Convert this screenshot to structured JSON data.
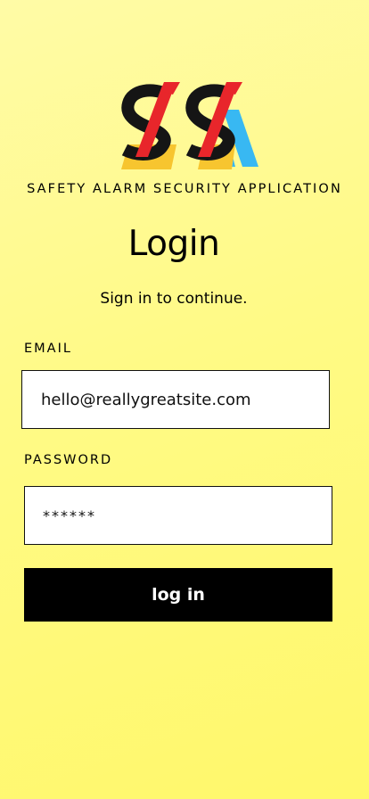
{
  "app": {
    "name": "SAFETY ALARM SECURITY APPLICATION",
    "logo_icon": "ssa-logo-icon"
  },
  "login": {
    "title": "Login",
    "subtitle": "Sign in to continue.",
    "email_label": "EMAIL",
    "email_value": "hello@reallygreatsite.com",
    "password_label": "PASSWORD",
    "password_value": "******",
    "button_label": "log in"
  },
  "colors": {
    "background": "#fffa86",
    "button": "#000000",
    "button_text": "#ffffff",
    "logo_red": "#e8262b",
    "logo_yellow": "#f7c52f",
    "logo_blue": "#38b8f2",
    "logo_black": "#151515"
  }
}
